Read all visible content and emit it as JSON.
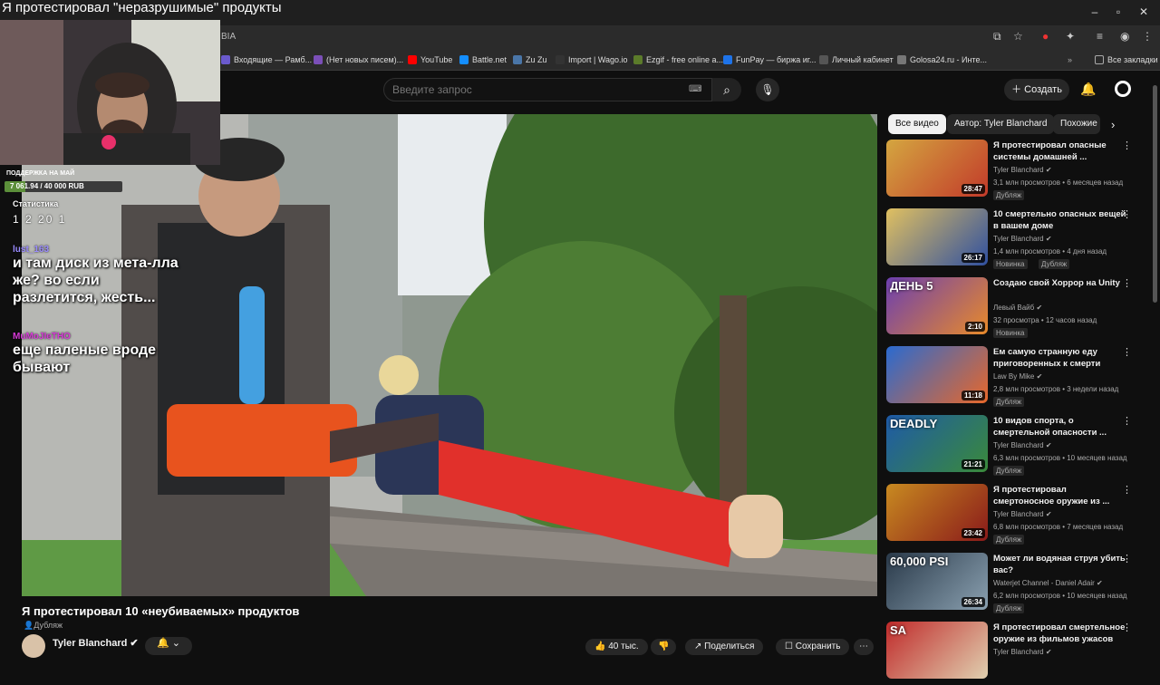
{
  "stream_title": "Я протестировал \"неразрушимые\" продукты",
  "browser": {
    "url": "BIA",
    "bookmarks": [
      {
        "label": "Входящие — Рамб...",
        "color": "#6a5acd"
      },
      {
        "label": "(Нет новых писем)...",
        "color": "#7b4fb8"
      },
      {
        "label": "YouTube",
        "color": "#ff0000"
      },
      {
        "label": "Battle.net",
        "color": "#148eff"
      },
      {
        "label": "Zu Zu",
        "color": "#4a76a8"
      },
      {
        "label": "Import | Wago.io",
        "color": "#333333"
      },
      {
        "label": "Ezgif - free online a...",
        "color": "#5b7b2a"
      },
      {
        "label": "FunPay — биржа иг...",
        "color": "#1e73e8"
      },
      {
        "label": "Личный кабинет",
        "color": "#555555"
      },
      {
        "label": "Golosa24.ru - Инте...",
        "color": "#777777"
      }
    ],
    "all_bookmarks": "Все закладки"
  },
  "youtube": {
    "search_placeholder": "Введите запрос",
    "create_label": "Создать",
    "video_title": "Я протестировал 10 «неубиваемых» продуктов",
    "dub_label": "Дубляж",
    "channel": "Tyler Blanchard",
    "likes": "40 тыс.",
    "share": "Поделиться",
    "save": "Сохранить",
    "chips": [
      "Все видео",
      "Автор: Tyler Blanchard",
      "Похожие"
    ],
    "recommendations": [
      {
        "title": "Я протестировал опасные системы домашней ...",
        "channel": "Tyler Blanchard",
        "meta": "3,1 млн просмотров • 6 месяцев назад",
        "duration": "28:47",
        "badges": [
          "Дубляж"
        ],
        "thumb_text": "",
        "colors": [
          "#d4a640",
          "#c23a2a"
        ]
      },
      {
        "title": "10 смертельно опасных вещей в вашем доме",
        "channel": "Tyler Blanchard",
        "meta": "1,4 млн просмотров • 4 дня назад",
        "duration": "26:17",
        "badges": [
          "Новинка",
          "Дубляж"
        ],
        "thumb_text": "",
        "colors": [
          "#e0c060",
          "#3050a0"
        ]
      },
      {
        "title": "Создаю свой Хоррор на Unity",
        "channel": "Левый Вайб",
        "meta": "32 просмотра • 12 часов назад",
        "duration": "2:10",
        "badges": [
          "Новинка"
        ],
        "thumb_text": "ДЕНЬ 5",
        "colors": [
          "#6c3fb0",
          "#e88a2a"
        ]
      },
      {
        "title": "Ем самую странную еду приговоренных к смерти",
        "channel": "Law By Mike",
        "meta": "2,8 млн просмотров • 3 недели назад",
        "duration": "11:18",
        "badges": [
          "Дубляж"
        ],
        "thumb_text": "",
        "colors": [
          "#2a6ad0",
          "#e8682a"
        ]
      },
      {
        "title": "10 видов спорта, о смертельной опасности ...",
        "channel": "Tyler Blanchard",
        "meta": "6,3 млн просмотров • 10 месяцев назад",
        "duration": "21:21",
        "badges": [
          "Дубляж"
        ],
        "thumb_text": "DEADLY",
        "colors": [
          "#1e5aa8",
          "#3a8a3a"
        ]
      },
      {
        "title": "Я протестировал смертоносное оружие из ...",
        "channel": "Tyler Blanchard",
        "meta": "6,8 млн просмотров • 7 месяцев назад",
        "duration": "23:42",
        "badges": [
          "Дубляж"
        ],
        "thumb_text": "",
        "colors": [
          "#c88a20",
          "#8a1a1a"
        ]
      },
      {
        "title": "Может ли водяная струя убить вас?",
        "channel": "Waterjet Channel - Daniel Adair",
        "meta": "6,2 млн просмотров • 10 месяцев назад",
        "duration": "26:34",
        "badges": [
          "Дубляж"
        ],
        "thumb_text": "60,000 PSI",
        "colors": [
          "#2a3a4a",
          "#8aa0b0"
        ]
      },
      {
        "title": "Я протестировал смертельное оружие из фильмов ужасов",
        "channel": "Tyler Blanchard",
        "meta": "",
        "duration": "",
        "badges": [],
        "thumb_text": "SA",
        "colors": [
          "#c02a2a",
          "#e0d0b0"
        ]
      }
    ]
  },
  "overlay": {
    "donation_label": "ПОДДЕРЖКА НА МАЙ",
    "donation_value": "7 061.94 / 40 000 RUB",
    "donation_fraction": 0.1765,
    "stats_label": "Статистика",
    "stats_row": "1  2  20  1",
    "chat": [
      {
        "user": "lust_163",
        "user_color": "#9b8cff",
        "msg": "и там диск из мета-лла же? во если разлетится, жесть..."
      },
      {
        "user": "MuMoJIeTHO",
        "user_color": "#d63ad6",
        "msg": "еще паленые вроде бывают"
      }
    ]
  }
}
